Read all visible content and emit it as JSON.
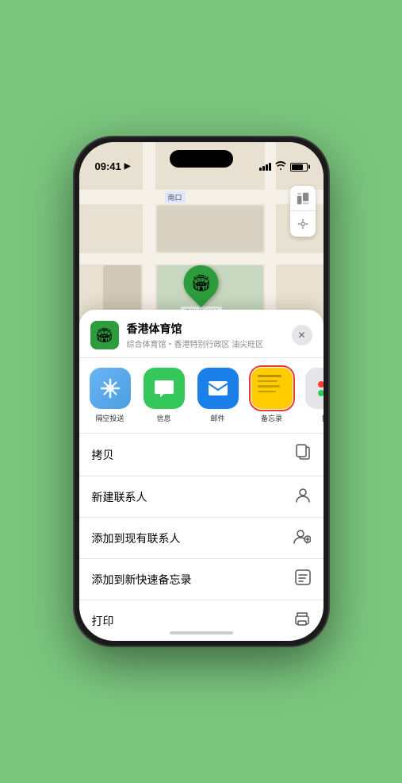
{
  "status_bar": {
    "time": "09:41",
    "location_icon": "▶"
  },
  "map": {
    "label": "南口",
    "controls": {
      "map_view": "🗺",
      "location": "◎"
    }
  },
  "pin": {
    "label": "香港体育馆",
    "emoji": "🏟"
  },
  "sheet": {
    "venue_name": "香港体育馆",
    "venue_subtitle": "综合体育馆・香港特别行政区 油尖旺区",
    "close_label": "✕"
  },
  "share_items": [
    {
      "id": "airdrop",
      "label": "隔空投送",
      "emoji": "📡"
    },
    {
      "id": "messages",
      "label": "信息",
      "emoji": "💬"
    },
    {
      "id": "mail",
      "label": "邮件",
      "emoji": "✉️"
    },
    {
      "id": "notes",
      "label": "备忘录",
      "emoji": "📝"
    },
    {
      "id": "more",
      "label": "提",
      "emoji": "···"
    }
  ],
  "actions": [
    {
      "id": "copy",
      "label": "拷贝",
      "icon": "⎘"
    },
    {
      "id": "new-contact",
      "label": "新建联系人",
      "icon": "👤"
    },
    {
      "id": "add-existing",
      "label": "添加到现有联系人",
      "icon": "👤"
    },
    {
      "id": "quick-note",
      "label": "添加到新快速备忘录",
      "icon": "🗒"
    },
    {
      "id": "print",
      "label": "打印",
      "icon": "🖨"
    }
  ]
}
